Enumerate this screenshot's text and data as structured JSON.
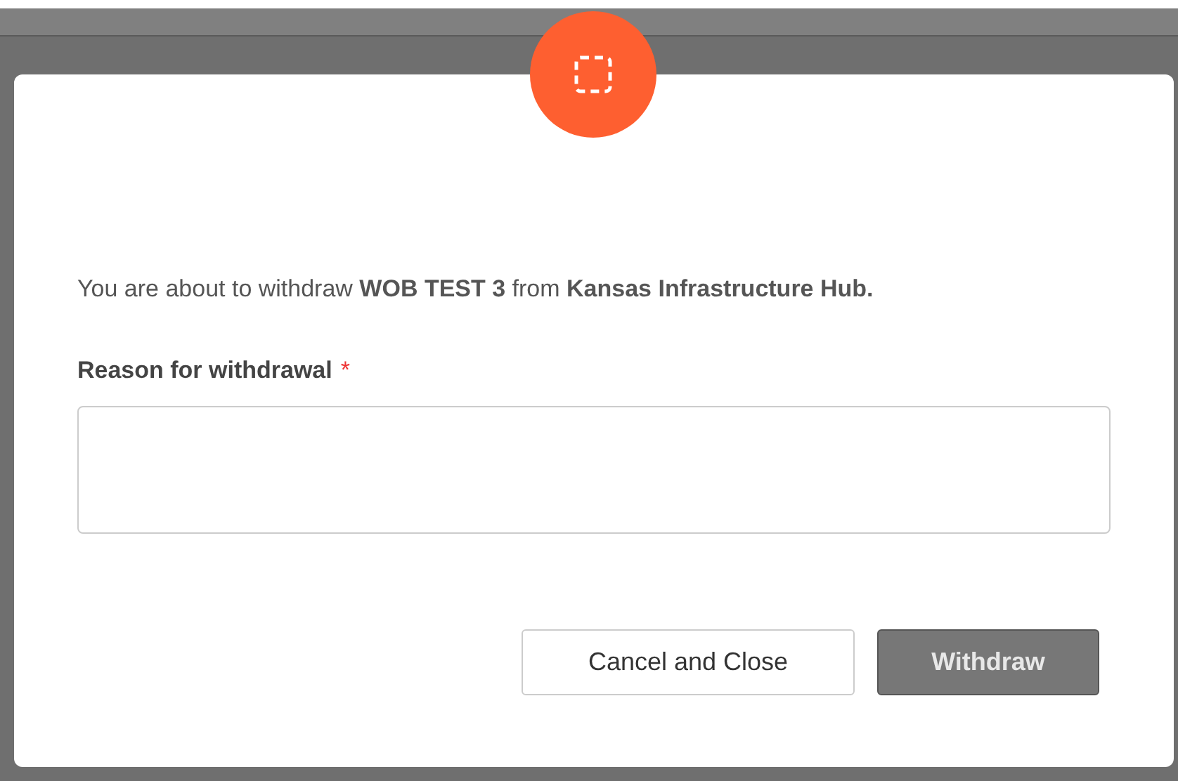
{
  "dialog": {
    "message": "You are about to withdraw **WOB TEST 3** from **Kansas Infrastructure Hub.**",
    "field": {
      "label": "Reason for withdrawal",
      "required": true,
      "required_mark": "*"
    },
    "buttons": [
      {
        "kind": "secondary",
        "label": "Cancel and Close",
        "disabled": false
      },
      {
        "kind": "primary",
        "label": "Withdraw",
        "disabled": true
      }
    ]
  }
}
